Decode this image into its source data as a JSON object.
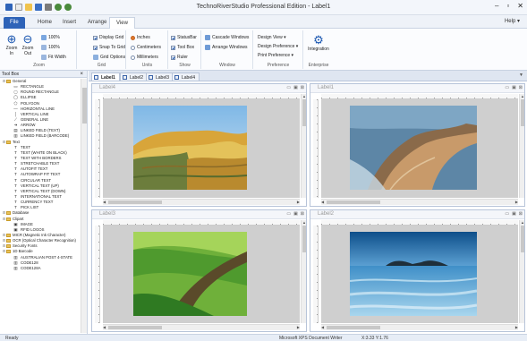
{
  "window": {
    "title": "TechnoRiverStudio Professional Edition - Label1",
    "minimize": "–",
    "maximize": "▫",
    "close": "✕"
  },
  "tabs": [
    "File",
    "Home",
    "Insert",
    "Arrange",
    "View"
  ],
  "help": "Help ▾",
  "ribbon": {
    "zoom": {
      "zoom_in": "Zoom\nIn",
      "zoom_out": "Zoom\nOut",
      "percent1": "100%",
      "percent2": "100%",
      "fit_width": "Fit Width",
      "title": "Zoom"
    },
    "grid": {
      "display_grid": "Display Grid",
      "snap_to_grid": "Snap To Grid",
      "grid_options": "Grid Options",
      "title": "Grid"
    },
    "units": {
      "inches": "Inches",
      "centimeters": "Centimeters",
      "millimeters": "Millimeters",
      "title": "Units"
    },
    "show": {
      "statusbar": "StatusBar",
      "toolbox": "Tool Box",
      "ruler": "Ruler",
      "title": "Show"
    },
    "window": {
      "cascade": "Cascade Windows",
      "arrange": "Arrange Windows",
      "title": "Window"
    },
    "preference": {
      "design_view": "Design View ▾",
      "design_preference": "Design Preference ▾",
      "print_preference": "Print Preference ▾",
      "title": "Preference"
    },
    "enterprise": {
      "integration": "Integration",
      "title": "Enterprise"
    }
  },
  "toolbox": {
    "title": "Tool Box",
    "items": [
      {
        "type": "group",
        "label": "General"
      },
      {
        "type": "item",
        "glyph": "▭",
        "label": "RECTANGLE"
      },
      {
        "type": "item",
        "glyph": "▢",
        "label": "ROUND RECTANGLE"
      },
      {
        "type": "item",
        "glyph": "◯",
        "label": "ELLIPSE"
      },
      {
        "type": "item",
        "glyph": "⬠",
        "label": "POLYGON"
      },
      {
        "type": "item",
        "glyph": "—",
        "label": "HORIZONTAL LINE"
      },
      {
        "type": "item",
        "glyph": "│",
        "label": "VERTICAL LINE"
      },
      {
        "type": "item",
        "glyph": "⟋",
        "label": "GENERAL LINE"
      },
      {
        "type": "item",
        "glyph": "➜",
        "label": "ARROW"
      },
      {
        "type": "item",
        "glyph": "▤",
        "label": "LINKED FIELD (TEXT)"
      },
      {
        "type": "item",
        "glyph": "▥",
        "label": "LINKED FIELD (BARCODE)"
      },
      {
        "type": "group",
        "label": "Text"
      },
      {
        "type": "item",
        "glyph": "T",
        "label": "TEXT"
      },
      {
        "type": "item",
        "glyph": "T",
        "label": "TEXT (WHITE ON BLACK)"
      },
      {
        "type": "item",
        "glyph": "T",
        "label": "TEXT WITH BORDERS"
      },
      {
        "type": "item",
        "glyph": "T",
        "label": "STRETCHABLE TEXT"
      },
      {
        "type": "item",
        "glyph": "T",
        "label": "AUTOFIT TEXT"
      },
      {
        "type": "item",
        "glyph": "T",
        "label": "AUTOWRAP FIT TEXT"
      },
      {
        "type": "item",
        "glyph": "T",
        "label": "CIRCULAR TEXT"
      },
      {
        "type": "item",
        "glyph": "T",
        "label": "VERTICAL TEXT (UP)"
      },
      {
        "type": "item",
        "glyph": "T",
        "label": "VERTICAL TEXT (DOWN)"
      },
      {
        "type": "item",
        "glyph": "T",
        "label": "INTERNATIONAL TEXT"
      },
      {
        "type": "item",
        "glyph": "T",
        "label": "CURRENCY TEXT"
      },
      {
        "type": "item",
        "glyph": "T",
        "label": "PICK LIST"
      },
      {
        "type": "group",
        "label": "Database"
      },
      {
        "type": "group",
        "label": "Clipart"
      },
      {
        "type": "item",
        "glyph": "▣",
        "label": "IMAGE"
      },
      {
        "type": "item",
        "glyph": "▣",
        "label": "RFID LOGOS"
      },
      {
        "type": "group",
        "label": "MICR (Magnetic Ink Character)"
      },
      {
        "type": "group",
        "label": "OCR (Optical Character Recognition)"
      },
      {
        "type": "group",
        "label": "Security Fonts"
      },
      {
        "type": "group",
        "label": "1D Barcode"
      },
      {
        "type": "item",
        "glyph": "▥",
        "label": "AUSTRALIAN POST 4-STATE"
      },
      {
        "type": "item",
        "glyph": "▥",
        "label": "CODE128"
      },
      {
        "type": "item",
        "glyph": "▥",
        "label": "CODE128A"
      }
    ]
  },
  "doc_tabs": [
    "Label1",
    "Label2",
    "Label3",
    "Label4"
  ],
  "panes": [
    {
      "name": "Label4",
      "image": "yellow-hills"
    },
    {
      "name": "Label1",
      "image": "coastal-rocks"
    },
    {
      "name": "Label3",
      "image": "green-slope"
    },
    {
      "name": "Label2",
      "image": "blue-sea"
    }
  ],
  "status": {
    "left": "Ready",
    "printer": "Microsoft XPS Document Writer",
    "coords": "X:3.33  Y:1.76"
  }
}
